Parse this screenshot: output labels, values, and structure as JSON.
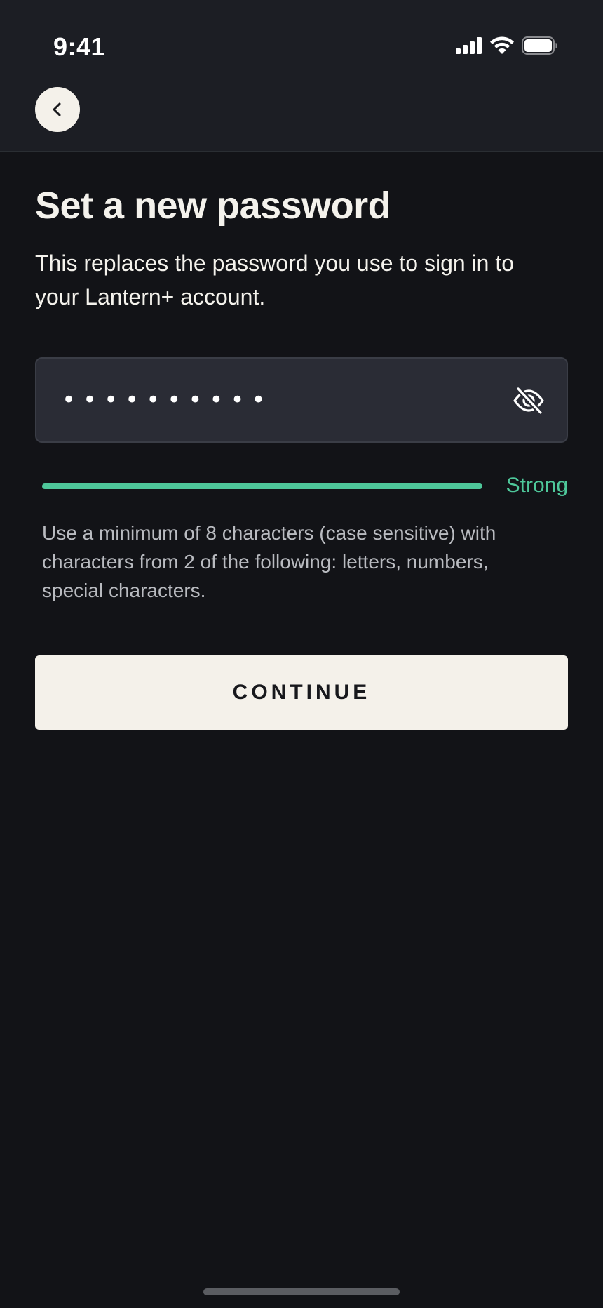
{
  "status_bar": {
    "time": "9:41",
    "icons": [
      "cellular-signal-icon",
      "wifi-icon",
      "battery-icon"
    ]
  },
  "nav": {
    "back_icon": "chevron-left-icon"
  },
  "page": {
    "title": "Set a new password",
    "subtitle": "This replaces the password you use to sign in to your Lantern+ account."
  },
  "password": {
    "value": "••••••••••",
    "toggle_icon": "eye-off-icon",
    "strength_label": "Strong",
    "strength_fraction": 1.0,
    "hint": "Use a minimum of 8 characters (case sensitive) with characters from 2 of the following: letters, numbers, special characters."
  },
  "actions": {
    "continue_label": "CONTINUE"
  },
  "colors": {
    "background": "#121317",
    "header": "#1c1e24",
    "field": "#2a2c35",
    "accent_strength": "#4ec79a",
    "button": "#f4f1ea"
  }
}
